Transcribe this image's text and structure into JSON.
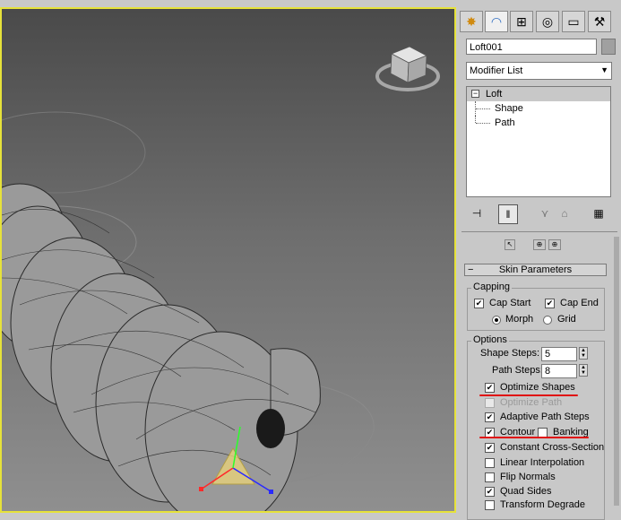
{
  "panel": {
    "tabs": [
      {
        "name": "create-tab-icon",
        "glyph": "✸"
      },
      {
        "name": "modify-tab-icon",
        "glyph": "◠"
      },
      {
        "name": "hierarchy-tab-icon",
        "glyph": "⊞"
      },
      {
        "name": "motion-tab-icon",
        "glyph": "◎"
      },
      {
        "name": "display-tab-icon",
        "glyph": "▭"
      },
      {
        "name": "utilities-tab-icon",
        "glyph": "⚒"
      }
    ],
    "object_name": "Loft001",
    "modifier_list": "Modifier List",
    "stack": {
      "root": "Loft",
      "children": [
        "Shape",
        "Path"
      ]
    },
    "skin": {
      "title": "Skin Parameters",
      "capping": {
        "title": "Capping",
        "cap_start": "Cap Start",
        "cap_end": "Cap End",
        "morph": "Morph",
        "grid": "Grid"
      },
      "options": {
        "title": "Options",
        "shape_steps_label": "Shape Steps:",
        "shape_steps_value": "5",
        "path_steps_label": "Path Steps:",
        "path_steps_value": "8",
        "optimize_shapes": "Optimize Shapes",
        "optimize_path": "Optimize Path",
        "adaptive_path_steps": "Adaptive Path Steps",
        "contour": "Contour",
        "banking": "Banking",
        "constant_cross_section": "Constant Cross-Section",
        "linear_interpolation": "Linear Interpolation",
        "flip_normals": "Flip Normals",
        "quad_sides": "Quad Sides",
        "transform_degrade": "Transform Degrade"
      }
    }
  },
  "colors": {
    "viewport_border": "#e6e23a",
    "annotation_red": "#e01010"
  }
}
